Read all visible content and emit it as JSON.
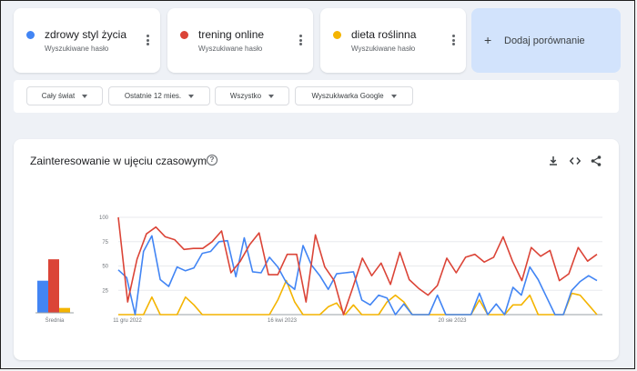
{
  "terms": [
    {
      "name": "zdrowy styl życia",
      "subtitle": "Wyszukiwane hasło",
      "color": "#4285f4"
    },
    {
      "name": "trening online",
      "subtitle": "Wyszukiwane hasło",
      "color": "#db4437"
    },
    {
      "name": "dieta roślinna",
      "subtitle": "Wyszukiwane hasło",
      "color": "#f4b400"
    }
  ],
  "add_comparison": {
    "label": "Dodaj porównanie",
    "icon": "plus-icon"
  },
  "filters": [
    {
      "label": "Cały świat"
    },
    {
      "label": "Ostatnie 12 mies."
    },
    {
      "label": "Wszystko"
    },
    {
      "label": "Wyszukiwarka Google"
    }
  ],
  "chart_card": {
    "title": "Zainteresowanie w ujęciu czasowym",
    "icons": [
      "help-icon",
      "download-icon",
      "embed-code-icon",
      "share-icon"
    ]
  },
  "chart_data": {
    "type": "line",
    "title": "Zainteresowanie w ujęciu czasowym",
    "ylim": [
      0,
      100
    ],
    "y_ticks": [
      "100",
      "75",
      "50",
      "25"
    ],
    "x_tick_labels": [
      "11 gru 2022",
      "16 kwi 2023",
      "20 sie 2023"
    ],
    "averages_label": "Średnia",
    "averages": [
      {
        "name": "zdrowy styl życia",
        "value": 33,
        "color": "#4285f4"
      },
      {
        "name": "trening online",
        "value": 55,
        "color": "#db4437"
      },
      {
        "name": "dieta roślinna",
        "value": 5,
        "color": "#f4b400"
      }
    ],
    "series": [
      {
        "name": "zdrowy styl życia",
        "color": "#4285f4",
        "values": [
          46,
          38,
          0,
          65,
          81,
          36,
          29,
          49,
          45,
          48,
          63,
          65,
          75,
          76,
          39,
          79,
          44,
          43,
          59,
          49,
          33,
          26,
          71,
          51,
          40,
          26,
          42,
          43,
          44,
          15,
          10,
          20,
          17,
          0,
          11,
          0,
          0,
          0,
          20,
          0,
          0,
          0,
          0,
          22,
          0,
          11,
          0,
          28,
          20,
          49,
          36,
          18,
          0,
          0,
          25,
          34,
          40,
          35
        ]
      },
      {
        "name": "trening online",
        "color": "#db4437",
        "values": [
          100,
          13,
          57,
          83,
          90,
          80,
          77,
          67,
          68,
          68,
          75,
          86,
          43,
          55,
          72,
          84,
          41,
          41,
          62,
          62,
          13,
          82,
          49,
          35,
          0,
          28,
          58,
          40,
          53,
          31,
          64,
          36,
          27,
          20,
          30,
          58,
          43,
          59,
          62,
          54,
          59,
          80,
          55,
          35,
          69,
          60,
          66,
          35,
          42,
          69,
          55,
          62
        ]
      },
      {
        "name": "dieta roślinna",
        "color": "#f4b400",
        "values": [
          0,
          0,
          0,
          0,
          18,
          0,
          0,
          0,
          18,
          10,
          0,
          0,
          0,
          0,
          0,
          0,
          0,
          0,
          0,
          15,
          35,
          13,
          0,
          0,
          0,
          8,
          12,
          0,
          10,
          0,
          0,
          0,
          13,
          20,
          13,
          0,
          0,
          0,
          0,
          0,
          0,
          0,
          0,
          15,
          0,
          0,
          0,
          10,
          10,
          20,
          0,
          0,
          0,
          0,
          22,
          20,
          10,
          0
        ]
      }
    ]
  }
}
